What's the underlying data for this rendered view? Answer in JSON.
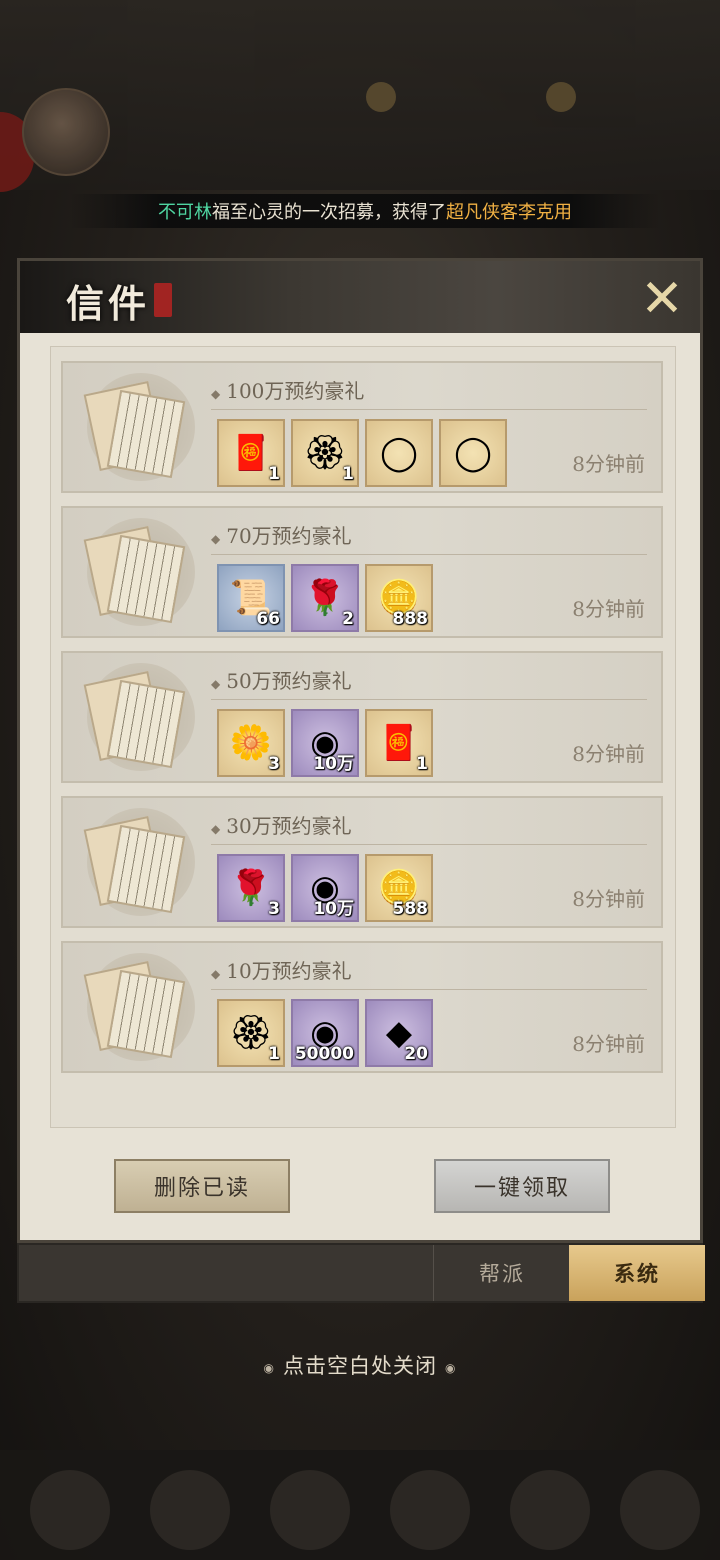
{
  "announcement": {
    "player": "不可林",
    "text1": "福至心灵的一次招募，获得了",
    "reward": "超凡侠客李克用"
  },
  "panel": {
    "title": "信件",
    "close_icon": "close-x-icon"
  },
  "mails": [
    {
      "title": "100万预约豪礼",
      "time": "8分钟前",
      "items": [
        {
          "icon": "red-token-icon",
          "glyph": "🧧",
          "rarity": "gold",
          "qty": "1"
        },
        {
          "icon": "gold-flower-icon",
          "glyph": "🏵",
          "rarity": "gold",
          "qty": "1"
        },
        {
          "icon": "avatar-frame-icon",
          "glyph": "◯",
          "rarity": "gold",
          "qty": ""
        },
        {
          "icon": "jade-frame-icon",
          "glyph": "◯",
          "rarity": "gold",
          "qty": ""
        }
      ]
    },
    {
      "title": "70万预约豪礼",
      "time": "8分钟前",
      "items": [
        {
          "icon": "scroll-icon",
          "glyph": "📜",
          "rarity": "blue",
          "qty": "66"
        },
        {
          "icon": "purple-rose-icon",
          "glyph": "🌹",
          "rarity": "purple",
          "qty": "2"
        },
        {
          "icon": "gold-ingot-icon",
          "glyph": "🪙",
          "rarity": "gold",
          "qty": "888"
        }
      ]
    },
    {
      "title": "50万预约豪礼",
      "time": "8分钟前",
      "items": [
        {
          "icon": "gold-rose-icon",
          "glyph": "🌼",
          "rarity": "gold",
          "qty": "3"
        },
        {
          "icon": "copper-coin-icon",
          "glyph": "◉",
          "rarity": "purple",
          "qty": "10万"
        },
        {
          "icon": "red-token-icon",
          "glyph": "🧧",
          "rarity": "gold",
          "qty": "1"
        }
      ]
    },
    {
      "title": "30万预约豪礼",
      "time": "8分钟前",
      "items": [
        {
          "icon": "purple-rose-icon",
          "glyph": "🌹",
          "rarity": "purple",
          "qty": "3"
        },
        {
          "icon": "copper-coin-icon",
          "glyph": "◉",
          "rarity": "purple",
          "qty": "10万"
        },
        {
          "icon": "gold-ingot-icon",
          "glyph": "🪙",
          "rarity": "gold",
          "qty": "588"
        }
      ]
    },
    {
      "title": "10万预约豪礼",
      "time": "8分钟前",
      "items": [
        {
          "icon": "gold-flower-icon",
          "glyph": "🏵",
          "rarity": "gold",
          "qty": "1"
        },
        {
          "icon": "copper-coin-icon",
          "glyph": "◉",
          "rarity": "purple",
          "qty": "50000"
        },
        {
          "icon": "iron-ore-icon",
          "glyph": "◆",
          "rarity": "purple",
          "qty": "20"
        }
      ]
    }
  ],
  "buttons": {
    "delete_read": "删除已读",
    "claim_all": "一键领取"
  },
  "tabs": {
    "guild": "帮派",
    "system": "系统"
  },
  "hint": "点击空白处关闭"
}
